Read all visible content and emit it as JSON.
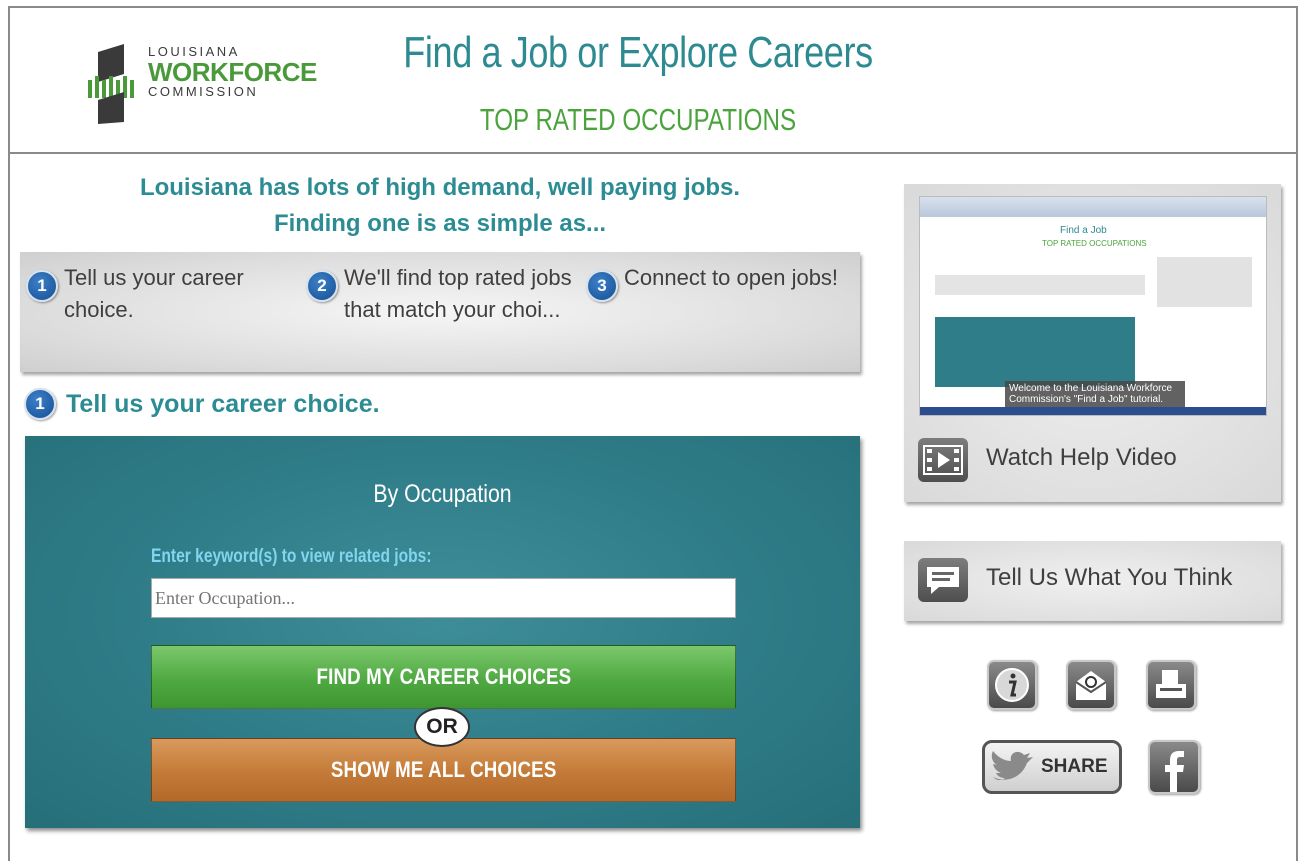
{
  "header": {
    "logo": {
      "line1": "LOUISIANA",
      "line2": "WORKFORCE",
      "line3": "COMMISSION"
    },
    "title": "Find a Job or Explore Careers",
    "subtitle": "TOP RATED OCCUPATIONS"
  },
  "intro": {
    "line1": "Louisiana has lots of high demand, well paying jobs.",
    "line2": "Finding one is as simple as..."
  },
  "steps": [
    {
      "num": "1",
      "text": "Tell us your career choice."
    },
    {
      "num": "2",
      "text": "We'll find top rated jobs that match your choi..."
    },
    {
      "num": "3",
      "text": "Connect to open jobs!"
    }
  ],
  "section": {
    "num": "1",
    "title": "Tell us your career choice."
  },
  "occupation_panel": {
    "title": "By Occupation",
    "keyword_label": "Enter keyword(s) to view related jobs:",
    "input_placeholder": "Enter Occupation...",
    "find_button": "FIND MY CAREER CHOICES",
    "or_label": "OR",
    "show_all_button": "SHOW ME ALL CHOICES"
  },
  "sidebar": {
    "video_caption": "Welcome to the Louisiana Workforce Commission's \"Find a Job\" tutorial.",
    "video_thumb_title": "Find a Job",
    "video_thumb_subtitle": "TOP RATED OCCUPATIONS",
    "watch_video_label": "Watch Help Video",
    "feedback_label": "Tell Us What You Think",
    "share_label": "SHARE"
  },
  "colors": {
    "teal": "#2d8a91",
    "green": "#4aa43b",
    "panel": "#2f7d89",
    "orange": "#c47a37",
    "step_blue": "#1e5fa8"
  },
  "icons": [
    "info-icon",
    "email-icon",
    "print-icon",
    "twitter-bird-icon",
    "facebook-icon",
    "video-icon",
    "chat-icon"
  ]
}
